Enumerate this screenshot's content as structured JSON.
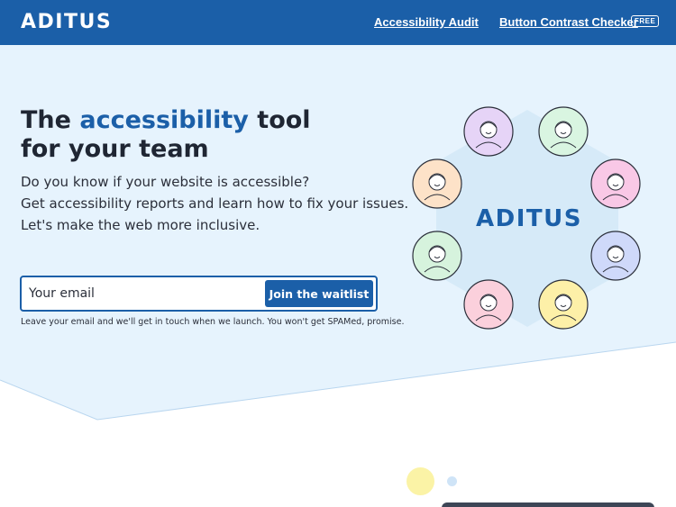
{
  "header": {
    "logo": "ADITUS",
    "nav": [
      {
        "label": "Accessibility Audit"
      },
      {
        "label": "Button Contrast Checker",
        "badge": "FREE"
      }
    ]
  },
  "hero": {
    "headline_pre": "The ",
    "headline_accent": "accessibility",
    "headline_post": " tool",
    "headline_line2": "for your team",
    "subtext": [
      "Do you know if your website is accessible?",
      "Get accessibility reports and learn how to fix your issues.",
      "Let's make the web more inclusive."
    ],
    "email_placeholder": "Your email",
    "join_label": "Join the waitlist",
    "note": "Leave your email and we'll get in touch when we launch. You won't get SPAMed, promise."
  },
  "cluster": {
    "logo": "ADITUS",
    "avatars": [
      {
        "name": "bearded-elder-avatar",
        "color": "#e6d4f7"
      },
      {
        "name": "girl-buns-avatar",
        "color": "#d9f5e1"
      },
      {
        "name": "graduate-avatar",
        "color": "#f9c8e6"
      },
      {
        "name": "hat-man-avatar",
        "color": "#cfd9fa"
      },
      {
        "name": "cap-boy-avatar",
        "color": "#fdf0a8"
      },
      {
        "name": "woman-avatar",
        "color": "#fbd0dc"
      },
      {
        "name": "glasses-man-avatar",
        "color": "#d6f3dd"
      },
      {
        "name": "bangs-woman-avatar",
        "color": "#fde2c8"
      }
    ]
  },
  "colors": {
    "brand": "#1b5fa8",
    "hero_bg": "#e6f3fd",
    "hex_bg": "#d6eaf8"
  }
}
